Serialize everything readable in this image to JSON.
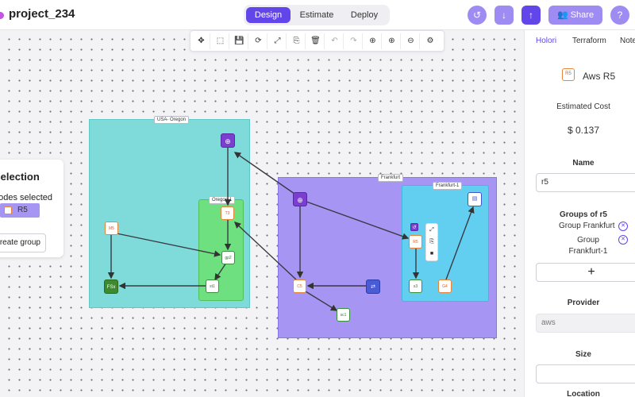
{
  "header": {
    "project_name": "project_234",
    "tabs": [
      {
        "label": "Design",
        "active": true
      },
      {
        "label": "Estimate",
        "active": false
      },
      {
        "label": "Deploy",
        "active": false
      }
    ],
    "history_icon": "history-icon",
    "download_icon": "download-icon",
    "upload_icon": "upload-icon",
    "share_label": "Share",
    "share_icon": "users-icon",
    "help_label": "?"
  },
  "toolbar": {
    "tools": [
      "move-icon",
      "select-area-icon",
      "save-icon",
      "refresh-icon",
      "expand-icon",
      "copy-icon",
      "delete-icon",
      "undo-icon",
      "redo-icon",
      "zoom-in-icon",
      "zoom-in-alt-icon",
      "zoom-out-icon",
      "settings-icon"
    ]
  },
  "canvas": {
    "regions": {
      "usa_oregon": "USA- Oregon",
      "oregon_1": "Oregon-1",
      "frankfurt": "Frankfurt",
      "frankfurt_1": "Frankfurt-1"
    },
    "nodes": {
      "gateway_top": "⊕",
      "gateway_frankfurt": "⊕",
      "m5": "M5",
      "t3": "T3",
      "gp2": "gp2",
      "st1": "st1",
      "fsx": "FSx",
      "c5": "C5",
      "vpc": "⇄",
      "s3": "sc1",
      "r5": "R5",
      "g4": "G4",
      "s3_frankfurt": "s3",
      "db": "▤",
      "small_node": "↺"
    },
    "mini_tools": [
      "⤢",
      "⎘",
      "■"
    ]
  },
  "selection_panel": {
    "title": "Selection",
    "subtitle": "nodes selected",
    "item_label": "R5",
    "create_group_label": "Create group"
  },
  "right_panel": {
    "tabs": [
      {
        "label": "Holori",
        "active": true
      },
      {
        "label": "Terraform",
        "active": false
      },
      {
        "label": "Notes",
        "active": false
      }
    ],
    "resource_icon_text": "R5",
    "resource_name": "Aws R5",
    "estimated_cost_label": "Estimated Cost",
    "estimated_cost_value": "$ 0.137",
    "name_label": "Name",
    "name_value": "r5",
    "groups_label": "Groups of r5",
    "groups": [
      "Group Frankfurt",
      "Group Frankfurt-1"
    ],
    "add_label": "+",
    "provider_label": "Provider",
    "provider_value": "aws",
    "size_label": "Size",
    "size_value": "",
    "next_label": "Location"
  },
  "colors": {
    "accent": "#6246ea",
    "accent_light": "#9e8cf3",
    "usa_oregon_region": "#7fdbd9",
    "oregon_1_zone": "#6fe07f",
    "frankfurt_region": "#a795f3",
    "frankfurt_1_zone": "#63cff0"
  }
}
